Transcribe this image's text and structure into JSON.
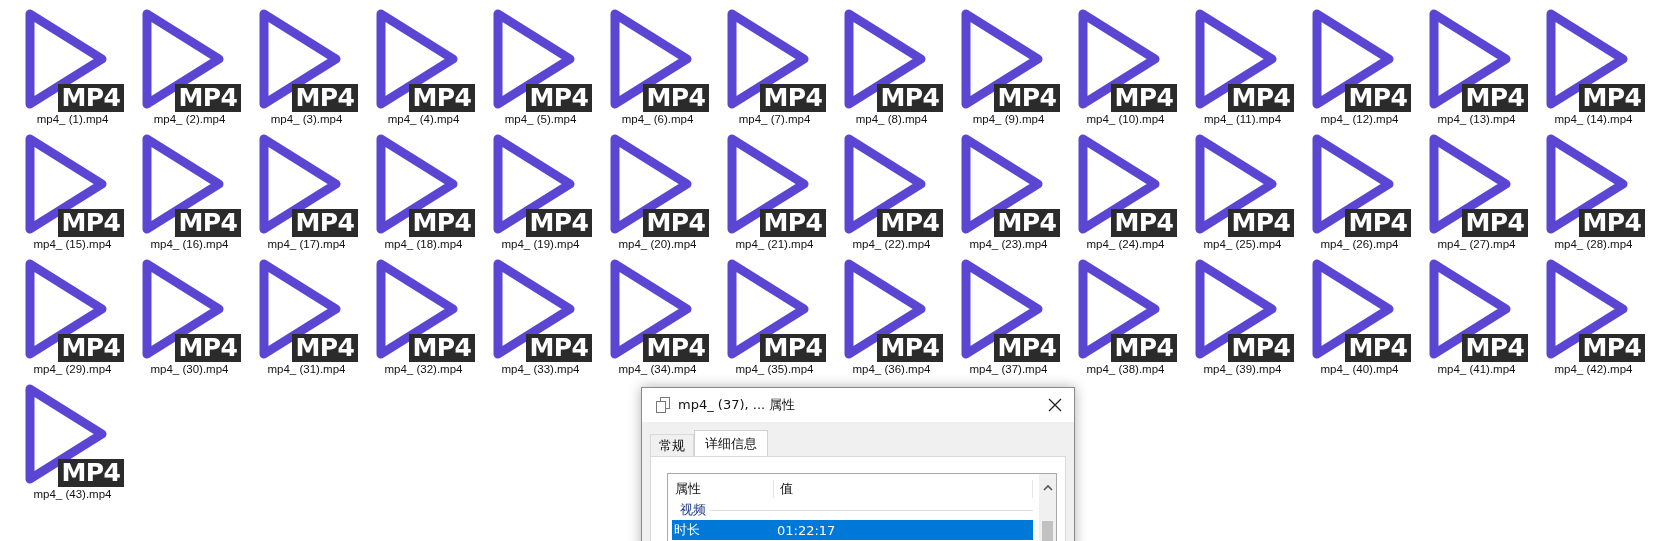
{
  "files": [
    {
      "name": "mp4_ (1).mp4",
      "badge": "MP4"
    },
    {
      "name": "mp4_ (2).mp4",
      "badge": "MP4"
    },
    {
      "name": "mp4_ (3).mp4",
      "badge": "MP4"
    },
    {
      "name": "mp4_ (4).mp4",
      "badge": "MP4"
    },
    {
      "name": "mp4_ (5).mp4",
      "badge": "MP4"
    },
    {
      "name": "mp4_ (6).mp4",
      "badge": "MP4"
    },
    {
      "name": "mp4_ (7).mp4",
      "badge": "MP4"
    },
    {
      "name": "mp4_ (8).mp4",
      "badge": "MP4"
    },
    {
      "name": "mp4_ (9).mp4",
      "badge": "MP4"
    },
    {
      "name": "mp4_ (10).mp4",
      "badge": "MP4"
    },
    {
      "name": "mp4_ (11).mp4",
      "badge": "MP4"
    },
    {
      "name": "mp4_ (12).mp4",
      "badge": "MP4"
    },
    {
      "name": "mp4_ (13).mp4",
      "badge": "MP4"
    },
    {
      "name": "mp4_ (14).mp4",
      "badge": "MP4"
    },
    {
      "name": "mp4_ (15).mp4",
      "badge": "MP4"
    },
    {
      "name": "mp4_ (16).mp4",
      "badge": "MP4"
    },
    {
      "name": "mp4_ (17).mp4",
      "badge": "MP4"
    },
    {
      "name": "mp4_ (18).mp4",
      "badge": "MP4"
    },
    {
      "name": "mp4_ (19).mp4",
      "badge": "MP4"
    },
    {
      "name": "mp4_ (20).mp4",
      "badge": "MP4"
    },
    {
      "name": "mp4_ (21).mp4",
      "badge": "MP4"
    },
    {
      "name": "mp4_ (22).mp4",
      "badge": "MP4"
    },
    {
      "name": "mp4_ (23).mp4",
      "badge": "MP4"
    },
    {
      "name": "mp4_ (24).mp4",
      "badge": "MP4"
    },
    {
      "name": "mp4_ (25).mp4",
      "badge": "MP4"
    },
    {
      "name": "mp4_ (26).mp4",
      "badge": "MP4"
    },
    {
      "name": "mp4_ (27).mp4",
      "badge": "MP4"
    },
    {
      "name": "mp4_ (28).mp4",
      "badge": "MP4"
    },
    {
      "name": "mp4_ (29).mp4",
      "badge": "MP4"
    },
    {
      "name": "mp4_ (30).mp4",
      "badge": "MP4"
    },
    {
      "name": "mp4_ (31).mp4",
      "badge": "MP4"
    },
    {
      "name": "mp4_ (32).mp4",
      "badge": "MP4"
    },
    {
      "name": "mp4_ (33).mp4",
      "badge": "MP4"
    },
    {
      "name": "mp4_ (34).mp4",
      "badge": "MP4"
    },
    {
      "name": "mp4_ (35).mp4",
      "badge": "MP4"
    },
    {
      "name": "mp4_ (36).mp4",
      "badge": "MP4"
    },
    {
      "name": "mp4_ (37).mp4",
      "badge": "MP4"
    },
    {
      "name": "mp4_ (38).mp4",
      "badge": "MP4"
    },
    {
      "name": "mp4_ (39).mp4",
      "badge": "MP4"
    },
    {
      "name": "mp4_ (40).mp4",
      "badge": "MP4"
    },
    {
      "name": "mp4_ (41).mp4",
      "badge": "MP4"
    },
    {
      "name": "mp4_ (42).mp4",
      "badge": "MP4"
    },
    {
      "name": "mp4_ (43).mp4",
      "badge": "MP4"
    }
  ],
  "dialog": {
    "title": "mp4_ (37), ... 属性",
    "tabs": [
      {
        "label": "常规",
        "selected": false
      },
      {
        "label": "详细信息",
        "selected": true
      }
    ],
    "table": {
      "columns": [
        "属性",
        "值"
      ],
      "groups": [
        {
          "label": "视频",
          "rows": [
            {
              "property": "时长",
              "value": "01:22:17",
              "selected": true
            }
          ]
        }
      ]
    }
  }
}
